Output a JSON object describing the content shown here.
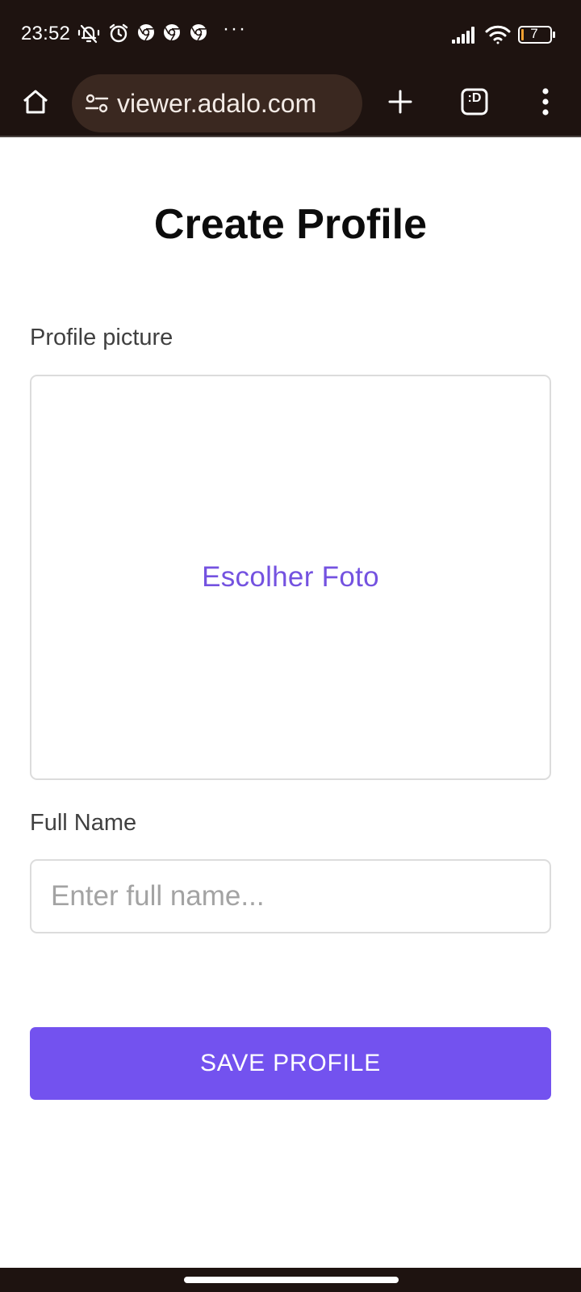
{
  "status_bar": {
    "time": "23:52",
    "icons": [
      "notifications-off-icon",
      "alarm-icon",
      "chrome-icon",
      "chrome-icon",
      "chrome-icon"
    ],
    "overflow": "···",
    "battery_level": "7",
    "right_icons": [
      "signal-icon",
      "wifi-icon",
      "battery-icon"
    ]
  },
  "browser": {
    "url": "viewer.adalo.com",
    "buttons": [
      "home-icon",
      "site-settings-icon",
      "new-tab-icon",
      "tab-switcher-icon",
      "more-icon"
    ],
    "tab_switcher_label": ":D"
  },
  "page": {
    "title": "Create Profile",
    "profile_picture_label": "Profile picture",
    "choose_photo": "Escolher Foto",
    "full_name_label": "Full Name",
    "full_name_placeholder": "Enter full name...",
    "full_name_value": "",
    "save_button": "SAVE PROFILE"
  },
  "colors": {
    "system_bar": "#1e1310",
    "url_bar": "#3a2820",
    "accent": "#7352ef",
    "link": "#7452e0",
    "input_border": "#dcdcdc"
  }
}
